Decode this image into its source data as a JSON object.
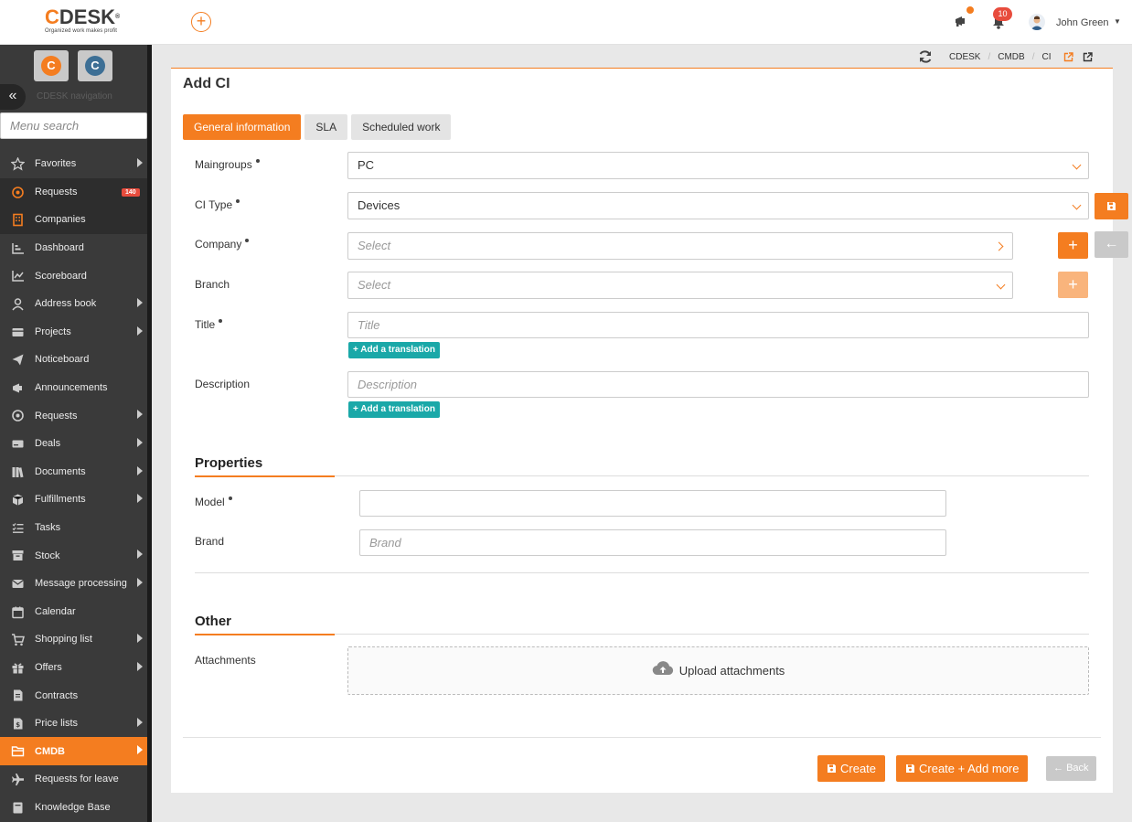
{
  "topbar": {
    "logo_text": "CDESK",
    "logo_tagline": "Organized work makes profit",
    "notif_count": "10",
    "user_name": "John Green"
  },
  "sidebar": {
    "nav_title": "CDESK navigation",
    "search_placeholder": "Menu search",
    "items": [
      {
        "label": "Favorites",
        "icon": "star-icon",
        "arrow": true
      },
      {
        "label": "Requests",
        "icon": "requests-icon",
        "badge": "140"
      },
      {
        "label": "Companies",
        "icon": "building-icon"
      },
      {
        "label": "Dashboard",
        "icon": "dashboard-icon"
      },
      {
        "label": "Scoreboard",
        "icon": "chart-icon"
      },
      {
        "label": "Address book",
        "icon": "user-icon",
        "arrow": true
      },
      {
        "label": "Projects",
        "icon": "projects-icon",
        "arrow": true
      },
      {
        "label": "Noticeboard",
        "icon": "paper-plane-icon"
      },
      {
        "label": "Announcements",
        "icon": "megaphone-icon"
      },
      {
        "label": "Requests",
        "icon": "requests-icon",
        "arrow": true
      },
      {
        "label": "Deals",
        "icon": "deals-icon",
        "arrow": true
      },
      {
        "label": "Documents",
        "icon": "documents-icon",
        "arrow": true
      },
      {
        "label": "Fulfillments",
        "icon": "box-icon",
        "arrow": true
      },
      {
        "label": "Tasks",
        "icon": "tasks-icon"
      },
      {
        "label": "Stock",
        "icon": "stock-icon",
        "arrow": true
      },
      {
        "label": "Message processing",
        "icon": "envelope-icon",
        "arrow": true
      },
      {
        "label": "Calendar",
        "icon": "calendar-icon"
      },
      {
        "label": "Shopping list",
        "icon": "cart-icon",
        "arrow": true
      },
      {
        "label": "Offers",
        "icon": "gift-icon",
        "arrow": true
      },
      {
        "label": "Contracts",
        "icon": "contract-icon"
      },
      {
        "label": "Price lists",
        "icon": "price-icon",
        "arrow": true
      },
      {
        "label": "CMDB",
        "icon": "folder-icon",
        "arrow": true
      },
      {
        "label": "Requests for leave",
        "icon": "plane-icon"
      },
      {
        "label": "Knowledge Base",
        "icon": "book-icon"
      }
    ]
  },
  "breadcrumb": [
    "CDESK",
    "CMDB",
    "CI"
  ],
  "page": {
    "title": "Add CI",
    "tabs": [
      "General information",
      "SLA",
      "Scheduled work"
    ],
    "fields": {
      "maingroups_label": "Maingroups",
      "maingroups_value": "PC",
      "citype_label": "CI Type",
      "citype_value": "Devices",
      "company_label": "Company",
      "company_placeholder": "Select",
      "branch_label": "Branch",
      "branch_placeholder": "Select",
      "title_label": "Title",
      "title_placeholder": "Title",
      "description_label": "Description",
      "description_placeholder": "Description",
      "add_translation": "+ Add a translation"
    },
    "properties": {
      "heading": "Properties",
      "model_label": "Model",
      "model_value": "",
      "brand_label": "Brand",
      "brand_placeholder": "Brand"
    },
    "other": {
      "heading": "Other",
      "attachments_label": "Attachments",
      "upload_label": "Upload attachments"
    },
    "footer": {
      "create": "Create",
      "create_more": "Create + Add more",
      "back": "Back"
    }
  },
  "colors": {
    "accent": "#f47d20",
    "teal": "#1aa8a8",
    "sidebar_bg": "#3a3a3a"
  }
}
